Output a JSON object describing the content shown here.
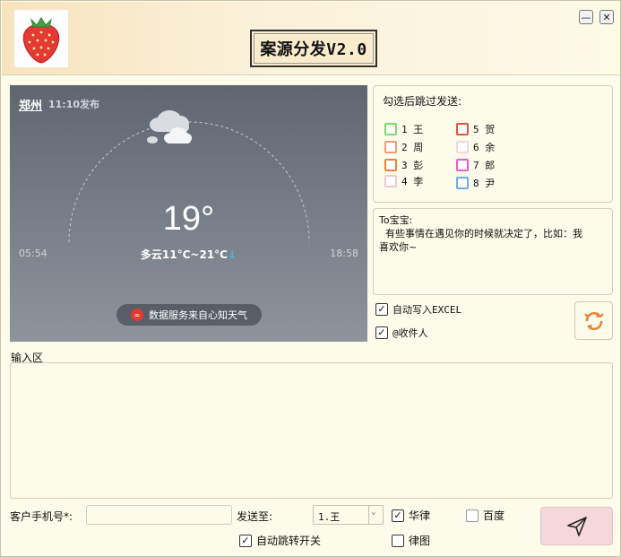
{
  "header": {
    "app_title": "案源分发V2.0",
    "logo_icon": "strawberry-icon",
    "minimize_icon": "minimize-icon",
    "close_icon": "close-icon"
  },
  "weather": {
    "city": "郑州",
    "publish_time": "11:10发布",
    "temperature": "19°",
    "description": "多云11°C~21°C",
    "trend_arrow": "↓",
    "sunrise": "05:54",
    "sunset": "18:58",
    "source": "数据服务来自心知天气",
    "condition_icon": "cloudy-icon"
  },
  "skip_panel": {
    "title": "勾选后跳过发送:",
    "recipients": [
      {
        "label": "1 王",
        "color": "#7ddc6e"
      },
      {
        "label": "2 周",
        "color": "#e6a07a"
      },
      {
        "label": "3 彭",
        "color": "#e8833a"
      },
      {
        "label": "4 李",
        "color": "#f2c8d6"
      },
      {
        "label": "5 贺",
        "color": "#e0553f"
      },
      {
        "label": "6 余",
        "color": "#f6d6e2"
      },
      {
        "label": "7 郎",
        "color": "#e85ad0"
      },
      {
        "label": "8 尹",
        "color": "#6aaef0"
      }
    ]
  },
  "message": {
    "text": "To宝宝:\n  有些事情在遇见你的时候就决定了，比如：我\n喜欢你~"
  },
  "options": {
    "auto_excel": "自动写入EXCEL",
    "auto_excel_checked": "✓",
    "at_recipient": "@收件人",
    "at_recipient_checked": "✓"
  },
  "input": {
    "label": "输入区",
    "phone_label": "客户手机号*:",
    "send_to_label": "发送至:",
    "send_to_value": "1.王",
    "huaiv": "华律",
    "huaiv_checked": "✓",
    "baidu": "百度",
    "auto_jump": "自动跳转开关",
    "auto_jump_checked": "✓",
    "lvtu": "律图"
  },
  "colors": {
    "background": "#fdfbe9",
    "send_button": "#f6d7da",
    "accent_refresh": "#e8833a"
  }
}
